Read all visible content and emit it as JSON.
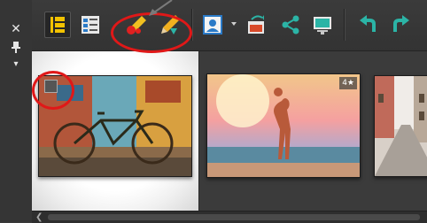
{
  "side_panel": {
    "close_glyph": "✕",
    "pin_glyph": "ᵖ",
    "menu_glyph": "▾"
  },
  "toolbar": {
    "buttons": [
      {
        "icon": "film-strip-view-icon",
        "active": true
      },
      {
        "icon": "details-view-icon",
        "active": false
      },
      {
        "icon": "red-eye-brush-icon",
        "active": false
      },
      {
        "icon": "retouch-pencil-icon",
        "active": false
      },
      {
        "icon": "person-portrait-icon",
        "active": false
      },
      {
        "icon": "photo-stack-icon",
        "active": false
      },
      {
        "icon": "share-icon",
        "active": false
      },
      {
        "icon": "slideshow-icon",
        "active": false
      },
      {
        "icon": "rotate-left-icon",
        "active": false
      },
      {
        "icon": "rotate-right-icon",
        "active": false
      }
    ]
  },
  "thumbnails": [
    {
      "name": "bicycle-photo",
      "selected": true,
      "rating": ""
    },
    {
      "name": "sunset-beach-photo",
      "selected": false,
      "rating": "4★"
    },
    {
      "name": "street-photo",
      "selected": false,
      "rating": ""
    }
  ],
  "scroll": {
    "arrow_glyph": "❮"
  },
  "colors": {
    "annotation": "#e01818",
    "accent_teal": "#2bb4a6"
  }
}
